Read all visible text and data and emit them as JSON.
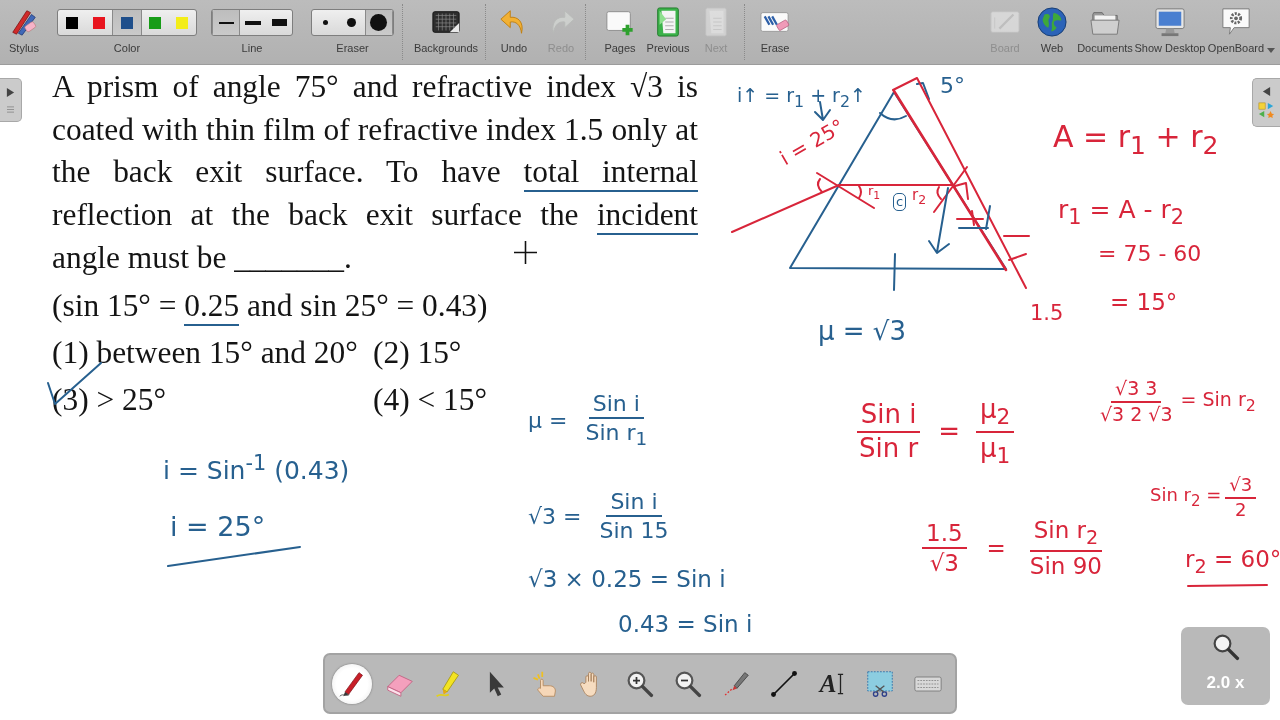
{
  "toolbar": {
    "stylus": {
      "label": "Stylus"
    },
    "color": {
      "label": "Color",
      "swatches": [
        {
          "color": "#000000",
          "selected": false
        },
        {
          "color": "#e8141e",
          "selected": false
        },
        {
          "color": "#1f4f8b",
          "selected": true
        },
        {
          "color": "#179c17",
          "selected": false
        },
        {
          "color": "#f3ed18",
          "selected": false
        }
      ]
    },
    "line": {
      "label": "Line",
      "widths": [
        {
          "selected": true
        },
        {
          "selected": false
        },
        {
          "selected": false
        }
      ]
    },
    "eraser": {
      "label": "Eraser",
      "sizes": [
        {
          "selected": false
        },
        {
          "selected": false
        },
        {
          "selected": true
        }
      ]
    },
    "buttons": [
      {
        "label": "Backgrounds",
        "disabled": false
      },
      {
        "label": "Undo",
        "disabled": false
      },
      {
        "label": "Redo",
        "disabled": true
      },
      {
        "label": "Pages",
        "disabled": false
      },
      {
        "label": "Previous",
        "disabled": false
      },
      {
        "label": "Next",
        "disabled": true
      },
      {
        "label": "Erase",
        "disabled": false
      }
    ],
    "modes": [
      {
        "label": "Board",
        "disabled": true
      },
      {
        "label": "Web",
        "disabled": false
      },
      {
        "label": "Documents",
        "disabled": false
      },
      {
        "label": "Show Desktop",
        "disabled": false
      },
      {
        "label": "OpenBoard",
        "disabled": false
      }
    ]
  },
  "board": {
    "question": {
      "parts": [
        {
          "text": "A prism of angle 75° and refractive index √3 is coated with thin film of refractive index 1.5 only at the back exit surface. To have",
          "underlined": false
        },
        {
          "text": "total internal",
          "underlined": true
        },
        {
          "text": "reflection at the back exit surface the",
          "underlined": false
        },
        {
          "text": "incident",
          "underlined": true
        },
        {
          "text": "angle must be _______.",
          "underlined": false
        }
      ],
      "given": [
        {
          "text": "(sin 15° =",
          "underlined": false
        },
        {
          "text": "0.25",
          "underlined": true
        },
        {
          "text": "and sin 25° = 0.43)",
          "underlined": false
        }
      ],
      "options": [
        {
          "text": "(1) between 15° and 20°",
          "ticked": false
        },
        {
          "text": "(2) 15°",
          "ticked": false
        },
        {
          "text": "(3) > 25°",
          "ticked": true
        },
        {
          "text": "(4) < 15°",
          "ticked": false
        }
      ]
    },
    "notes": [
      {
        "color": "#27608f",
        "parts": [
          {
            "kind": "text",
            "text": "i↑ = r$_{1}$ + r$_{2}$↑"
          }
        ]
      },
      {
        "color": "#27608f",
        "parts": [
          {
            "kind": "text",
            "text": "5°"
          }
        ]
      },
      {
        "color": "#27608f",
        "parts": [
          {
            "kind": "boxed",
            "text": "c"
          }
        ]
      },
      {
        "color": "#27608f",
        "parts": [
          {
            "kind": "text",
            "text": "μ = √3"
          }
        ]
      },
      {
        "color": "#27608f",
        "parts": [
          {
            "kind": "text",
            "text": "μ ="
          },
          {
            "kind": "fraction",
            "numerator": "Sin i",
            "denominator": "Sin r$_{1}$"
          }
        ]
      },
      {
        "color": "#27608f",
        "parts": [
          {
            "kind": "text",
            "text": "√3 ="
          },
          {
            "kind": "fraction",
            "numerator": "Sin i",
            "denominator": "Sin 15"
          }
        ]
      },
      {
        "color": "#27608f",
        "parts": [
          {
            "kind": "text",
            "text": "√3 × 0.25 = Sin i"
          }
        ]
      },
      {
        "color": "#27608f",
        "parts": [
          {
            "kind": "text",
            "text": "0.43 = Sin i"
          }
        ]
      },
      {
        "color": "#27608f",
        "parts": [
          {
            "kind": "text",
            "text": "i = Sin$^{-1}$ (0.43)"
          }
        ]
      },
      {
        "color": "#27608f",
        "parts": [
          {
            "kind": "text",
            "text": "i = 25°"
          }
        ]
      },
      {
        "color": "#d8253a",
        "parts": [
          {
            "kind": "text",
            "text": "i = 25°"
          }
        ]
      },
      {
        "color": "#d8253a",
        "parts": [
          {
            "kind": "text",
            "text": "r$_{1}$"
          }
        ]
      },
      {
        "color": "#d8253a",
        "parts": [
          {
            "kind": "text",
            "text": "r$_{2}$"
          }
        ]
      },
      {
        "color": "#d8253a",
        "parts": [
          {
            "kind": "text",
            "text": "A = r$_{1}$ + r$_{2}$"
          }
        ]
      },
      {
        "color": "#d8253a",
        "parts": [
          {
            "kind": "text",
            "text": "r$_{1}$ = A - r$_{2}$"
          }
        ]
      },
      {
        "color": "#d8253a",
        "parts": [
          {
            "kind": "text",
            "text": "= 75 - 60"
          }
        ]
      },
      {
        "color": "#d8253a",
        "parts": [
          {
            "kind": "text",
            "text": "1.5"
          }
        ]
      },
      {
        "color": "#d8253a",
        "parts": [
          {
            "kind": "text",
            "text": "= 15°"
          }
        ]
      },
      {
        "color": "#d8253a",
        "parts": [
          {
            "kind": "fraction",
            "numerator": "Sin i",
            "denominator": "Sin r"
          },
          {
            "kind": "text",
            "text": "="
          },
          {
            "kind": "fraction",
            "numerator": "μ$_{2}$",
            "denominator": "μ$_{1}$"
          }
        ]
      },
      {
        "color": "#d8253a",
        "parts": [
          {
            "kind": "fraction",
            "numerator": "√3 3",
            "denominator": "√3 2 √3"
          },
          {
            "kind": "text",
            "text": "= Sin r$_{2}$"
          }
        ]
      },
      {
        "color": "#d8253a",
        "parts": [
          {
            "kind": "text",
            "text": "Sin r$_{2}$ ="
          },
          {
            "kind": "fraction",
            "numerator": "√3",
            "denominator": "2"
          }
        ]
      },
      {
        "color": "#d8253a",
        "parts": [
          {
            "kind": "fraction",
            "numerator": "1.5",
            "denominator": "√3"
          },
          {
            "kind": "text",
            "text": "="
          },
          {
            "kind": "fraction",
            "numerator": "Sin r$_{2}$",
            "denominator": "Sin 90"
          }
        ]
      },
      {
        "color": "#d8253a",
        "parts": [
          {
            "kind": "text",
            "text": "r$_{2}$ = 60°"
          }
        ]
      }
    ]
  },
  "tool_palette": {
    "tools": [
      {
        "selected": true
      },
      {
        "selected": false
      },
      {
        "selected": false
      },
      {
        "selected": false
      },
      {
        "selected": false
      },
      {
        "selected": false
      },
      {
        "selected": false
      },
      {
        "selected": false
      },
      {
        "selected": false
      },
      {
        "selected": false
      },
      {
        "selected": false,
        "label": "A"
      },
      {
        "selected": false
      },
      {
        "selected": false
      }
    ]
  },
  "zoom": {
    "label": "2.0 x"
  }
}
